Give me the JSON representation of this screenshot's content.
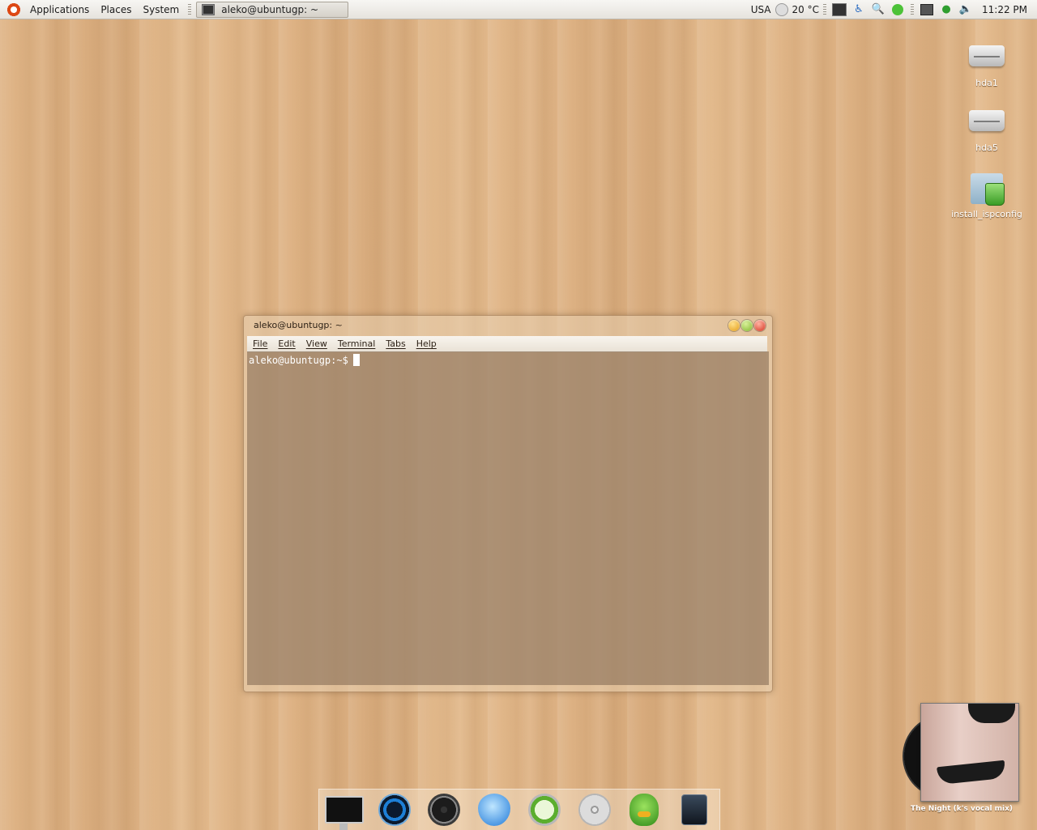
{
  "top_panel": {
    "menus": [
      "Applications",
      "Places",
      "System"
    ],
    "task_button_label": "aleko@ubuntugp: ~",
    "tray": {
      "keyboard_layout": "USA",
      "temperature": "20 °C",
      "clock": "11:22 PM"
    }
  },
  "desktop_icons": [
    {
      "label": "hda1",
      "icon": "drive-icon"
    },
    {
      "label": "hda5",
      "icon": "drive-icon"
    },
    {
      "label": "install_ispconfig",
      "icon": "folder-icon"
    }
  ],
  "terminal": {
    "title": "aleko@ubuntugp: ~",
    "menus": [
      "File",
      "Edit",
      "View",
      "Terminal",
      "Tabs",
      "Help"
    ],
    "prompt": "aleko@ubuntugp:~$"
  },
  "dock": {
    "items": [
      "monitor-icon",
      "media-player-icon",
      "dashboard-icon",
      "video-chat-icon",
      "safari-icon",
      "dvd-icon",
      "duck-messenger-icon",
      "speaker-icon"
    ]
  },
  "now_playing": {
    "caption": "The Night (k's vocal mix)"
  }
}
